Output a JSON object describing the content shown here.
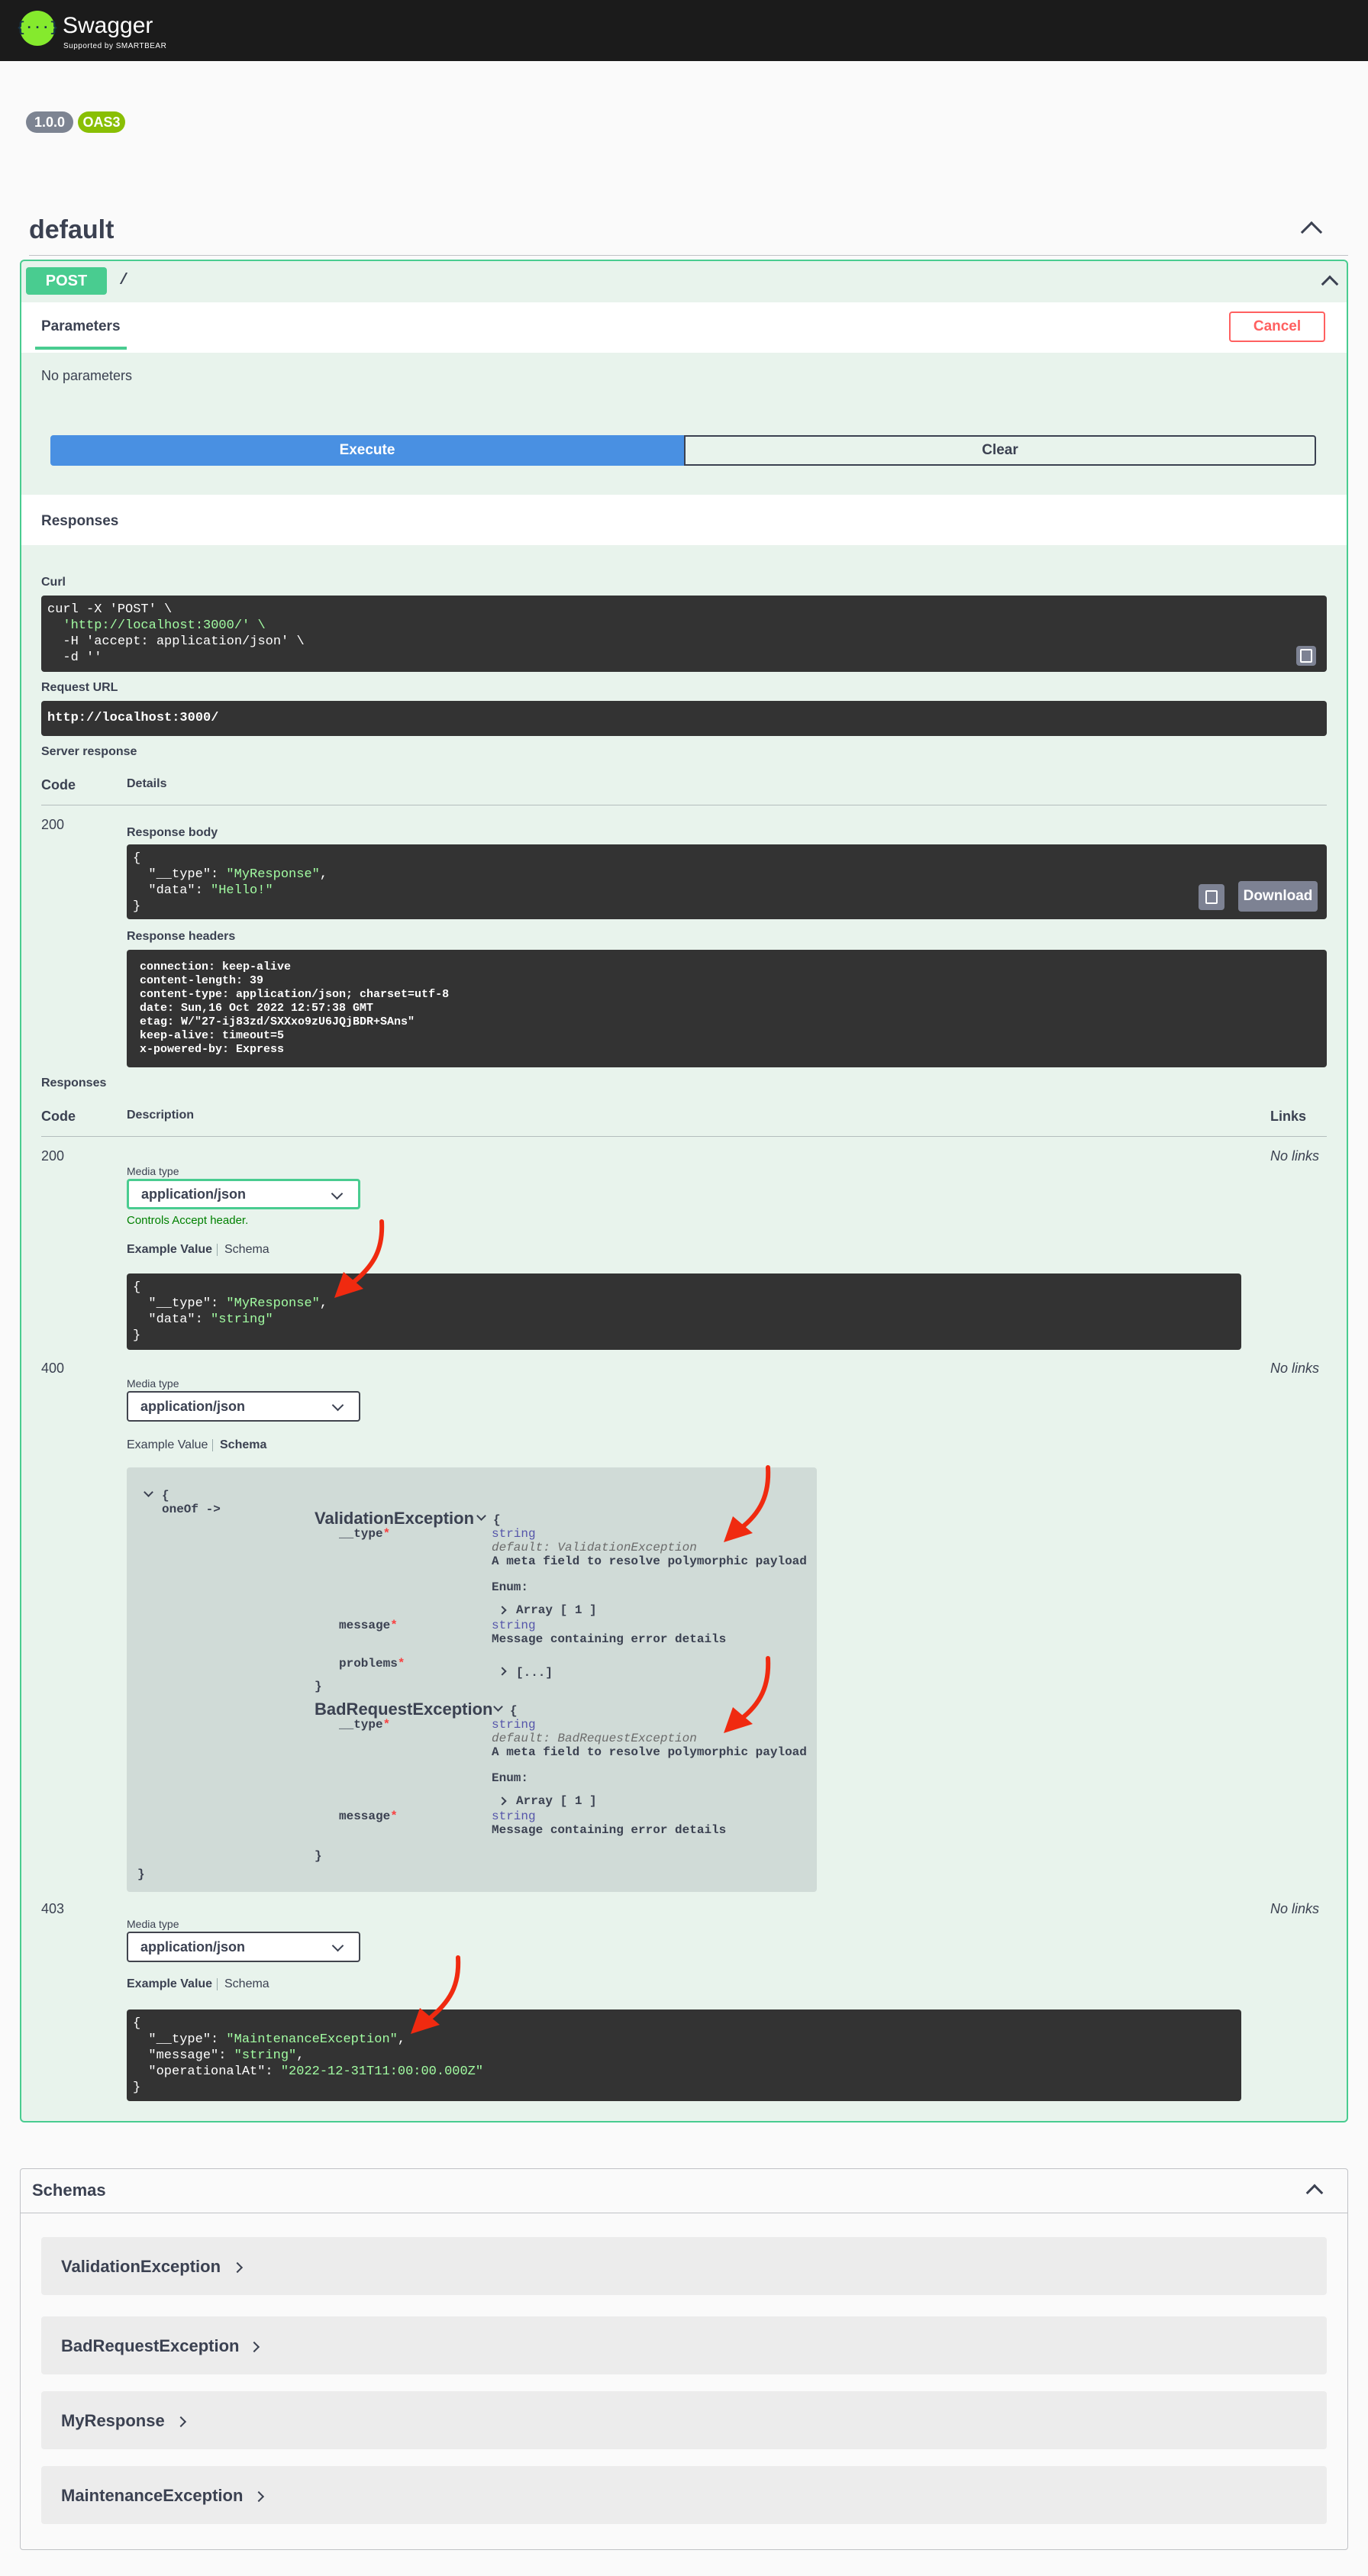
{
  "topbar": {
    "logo_glyph": "{···}",
    "title": "Swagger",
    "subtitle": "Supported by SMARTBEAR"
  },
  "info": {
    "version": "1.0.0",
    "oas": "OAS3"
  },
  "tag": {
    "name": "default"
  },
  "operation": {
    "method": "POST",
    "path": "/",
    "parameters_tab": "Parameters",
    "cancel_label": "Cancel",
    "no_params": "No parameters",
    "execute_label": "Execute",
    "clear_label": "Clear",
    "responses_heading": "Responses"
  },
  "live": {
    "curl_label": "Curl",
    "curl_lines": [
      "curl -X 'POST' \\",
      "  'http://localhost:3000/' \\",
      "  -H 'accept: application/json' \\",
      "  -d ''"
    ],
    "request_url_label": "Request URL",
    "request_url": "http://localhost:3000/",
    "server_response_label": "Server response",
    "code_header": "Code",
    "details_header": "Details",
    "code": "200",
    "response_body_label": "Response body",
    "body_lines": [
      "{",
      "  \"__type\": \"MyResponse\",",
      "  \"data\": \"Hello!\"",
      "}"
    ],
    "download_label": "Download",
    "response_headers_label": "Response headers",
    "header_lines": [
      " connection: keep-alive",
      " content-length: 39",
      " content-type: application/json; charset=utf-8",
      " date: Sun,16 Oct 2022 12:57:38 GMT",
      " etag: W/\"27-ij83zd/SXXxo9zU6JQjBDR+SAns\"",
      " keep-alive: timeout=5",
      " x-powered-by: Express"
    ]
  },
  "responses": {
    "heading": "Responses",
    "code_header": "Code",
    "description_header": "Description",
    "links_header": "Links",
    "media_type_label": "Media type",
    "media_type": "application/json",
    "accept_note": "Controls Accept header.",
    "example_tab": "Example Value",
    "schema_tab": "Schema",
    "no_links": "No links",
    "r200": {
      "code": "200",
      "lines": [
        "{",
        "  \"__type\": \"MyResponse\",",
        "  \"data\": \"string\"",
        "}"
      ]
    },
    "r400": {
      "code": "400"
    },
    "r403": {
      "code": "403",
      "lines": [
        "{",
        "  \"__type\": \"MaintenanceException\",",
        "  \"message\": \"string\",",
        "  \"operationalAt\": \"2022-12-31T11:00:00.000Z\"",
        "}"
      ]
    }
  },
  "schema400": {
    "open_brace": "{",
    "oneof": "oneOf ->",
    "close_brace": "}",
    "inner_open": "{",
    "inner_close": "}",
    "m1": {
      "name": "ValidationException",
      "type_field": "__type",
      "type_type": "string",
      "type_default": "default: ValidationException",
      "type_desc": "A meta field to resolve polymorphic payload",
      "enum_label": "Enum:",
      "enum_value": "Array [ 1 ]",
      "message_field": "message",
      "message_type": "string",
      "message_desc": "Message containing error details",
      "problems_field": "problems",
      "problems_value": "[...]"
    },
    "m2": {
      "name": "BadRequestException",
      "type_field": "__type",
      "type_type": "string",
      "type_default": "default: BadRequestException",
      "type_desc": "A meta field to resolve polymorphic payload",
      "enum_label": "Enum:",
      "enum_value": "Array [ 1 ]",
      "message_field": "message",
      "message_type": "string",
      "message_desc": "Message containing error details"
    },
    "required_mark": "*"
  },
  "schemas": {
    "title": "Schemas",
    "items": [
      "ValidationException",
      "BadRequestException",
      "MyResponse",
      "MaintenanceException"
    ]
  },
  "colors": {
    "post": "#49cc90",
    "execute": "#4990e2",
    "cancel": "#ff6060",
    "arrow": "#f02a10",
    "logo": "#85ea2d"
  }
}
